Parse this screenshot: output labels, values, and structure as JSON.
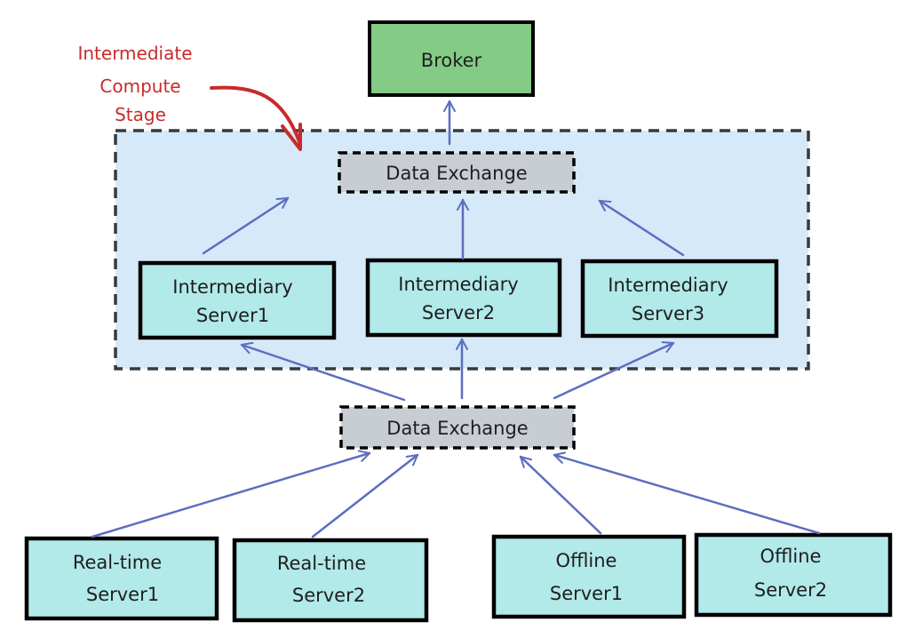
{
  "diagram": {
    "annotation": {
      "lines": [
        "Intermediate",
        "Compute",
        "Stage"
      ],
      "color": "#c92a2a"
    },
    "colors": {
      "broker_fill": "#84cb86",
      "server_fill": "#b2e9e9",
      "exchange_fill": "#c8ccd3",
      "stage_fill": "#d6e9f8",
      "stroke": "#000000",
      "arrow": "#5b6ec0"
    },
    "nodes": {
      "broker": {
        "label": "Broker"
      },
      "exchange_top": {
        "label": "Data Exchange"
      },
      "exchange_bottom": {
        "label": "Data Exchange"
      },
      "intermediary": [
        {
          "line1": "Intermediary",
          "line2": "Server1"
        },
        {
          "line1": "Intermediary",
          "line2": "Server2"
        },
        {
          "line1": "Intermediary",
          "line2": "Server3"
        }
      ],
      "sources": [
        {
          "line1": "Real-time",
          "line2": "Server1"
        },
        {
          "line1": "Real-time",
          "line2": "Server2"
        },
        {
          "line1": "Offline",
          "line2": "Server1"
        },
        {
          "line1": "Offline",
          "line2": "Server2"
        }
      ]
    },
    "edges": [
      {
        "from": "exchange_top",
        "to": "broker"
      },
      {
        "from": "intermediary-1",
        "to": "exchange_top"
      },
      {
        "from": "intermediary-2",
        "to": "exchange_top"
      },
      {
        "from": "intermediary-3",
        "to": "exchange_top"
      },
      {
        "from": "exchange_bottom",
        "to": "intermediary-1"
      },
      {
        "from": "exchange_bottom",
        "to": "intermediary-2"
      },
      {
        "from": "exchange_bottom",
        "to": "intermediary-3"
      },
      {
        "from": "realtime-server-1",
        "to": "exchange_bottom"
      },
      {
        "from": "realtime-server-2",
        "to": "exchange_bottom"
      },
      {
        "from": "offline-server-1",
        "to": "exchange_bottom"
      },
      {
        "from": "offline-server-2",
        "to": "exchange_bottom"
      }
    ]
  }
}
